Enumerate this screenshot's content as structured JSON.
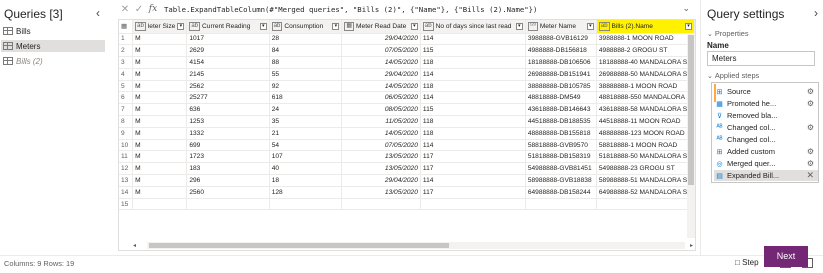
{
  "queries": {
    "title": "Queries [3]",
    "items": [
      {
        "label": "Bills"
      },
      {
        "label": "Meters"
      },
      {
        "label": "Bills (2)"
      }
    ]
  },
  "formula": {
    "expression": "Table.ExpandTableColumn(#\"Merged queries\", \"Bills (2)\", {\"Name\"}, {\"Bills (2).Name\"})"
  },
  "grid": {
    "columns": [
      {
        "label": "leter Size",
        "type": "abc"
      },
      {
        "label": "Current Reading",
        "type": "abc"
      },
      {
        "label": "Consumption",
        "type": "abc"
      },
      {
        "label": "Meter Read Date",
        "type": "date"
      },
      {
        "label": "No of days since last read",
        "type": "abc"
      },
      {
        "label": "Meter Name",
        "type": "ABC123"
      },
      {
        "label": "Bills (2).Name",
        "type": "abc"
      }
    ],
    "rows": [
      [
        "1",
        "M",
        "1017",
        "28",
        "29/04/2020",
        "114",
        "3988888-GVB16129",
        "3988888-1 MOON ROAD"
      ],
      [
        "2",
        "M",
        "2629",
        "84",
        "07/05/2020",
        "115",
        "4988888-DB156818",
        "4988888-2 GROGU ST"
      ],
      [
        "3",
        "M",
        "4154",
        "88",
        "14/05/2020",
        "118",
        "18188888-DB106506",
        "18188888-40 MANDALORA ST"
      ],
      [
        "4",
        "M",
        "2145",
        "55",
        "29/04/2020",
        "114",
        "26988888-DB151941",
        "26988888-50 MANDALORA ST"
      ],
      [
        "5",
        "M",
        "2562",
        "92",
        "14/05/2020",
        "118",
        "38888888-DB105785",
        "38888888-1 MOON ROAD"
      ],
      [
        "6",
        "M",
        "25277",
        "618",
        "06/05/2020",
        "114",
        "48818888-DM549",
        "48818888-550 MANDALORA ..."
      ],
      [
        "7",
        "M",
        "636",
        "24",
        "08/05/2020",
        "115",
        "43618888-DB146643",
        "43618888-58 MANDALORA ST"
      ],
      [
        "8",
        "M",
        "1253",
        "35",
        "11/05/2020",
        "118",
        "44518888-DB188535",
        "44518888-11 MOON ROAD"
      ],
      [
        "9",
        "M",
        "1332",
        "21",
        "14/05/2020",
        "118",
        "48888888-DB155818",
        "48888888-123 MOON ROAD"
      ],
      [
        "10",
        "M",
        "699",
        "54",
        "07/05/2020",
        "114",
        "58818888-GVB9570",
        "58818888-1 MOON ROAD"
      ],
      [
        "11",
        "M",
        "1723",
        "107",
        "13/05/2020",
        "117",
        "51818888-DB158319",
        "51818888-50 MANDALORA ST"
      ],
      [
        "12",
        "M",
        "183",
        "40",
        "13/05/2020",
        "117",
        "54988888-GVB81451",
        "54988888-23 GROGU ST"
      ],
      [
        "13",
        "M",
        "296",
        "18",
        "29/04/2020",
        "114",
        "58988888-GVB18838",
        "58988888-51 MANDALORA ST"
      ],
      [
        "14",
        "M",
        "2560",
        "128",
        "13/05/2020",
        "117",
        "64988888-DB158244",
        "64988888-52 MANDALORA ST"
      ],
      [
        "15",
        "",
        "",
        "",
        "",
        "",
        "",
        ""
      ]
    ]
  },
  "settings": {
    "title": "Query settings",
    "properties_label": "Properties",
    "name_label": "Name",
    "name_value": "Meters",
    "applied_steps_label": "Applied steps",
    "steps": [
      {
        "label": "Source",
        "icon": "source-icon"
      },
      {
        "label": "Promoted he...",
        "icon": "table-icon"
      },
      {
        "label": "Removed bla...",
        "icon": "filter-icon"
      },
      {
        "label": "Changed col...",
        "icon": "type-icon"
      },
      {
        "label": "Changed col...",
        "icon": "type-icon"
      },
      {
        "label": "Added custom",
        "icon": "custom-column-icon"
      },
      {
        "label": "Merged quer...",
        "icon": "merge-icon"
      },
      {
        "label": "Expanded Bill...",
        "icon": "expand-icon"
      }
    ]
  },
  "status": {
    "summary": "Columns: 9  Rows: 19",
    "step_label": "Step",
    "next_label": "Next"
  },
  "colors": {
    "accent": "#742774",
    "highlight": "#fff100"
  }
}
